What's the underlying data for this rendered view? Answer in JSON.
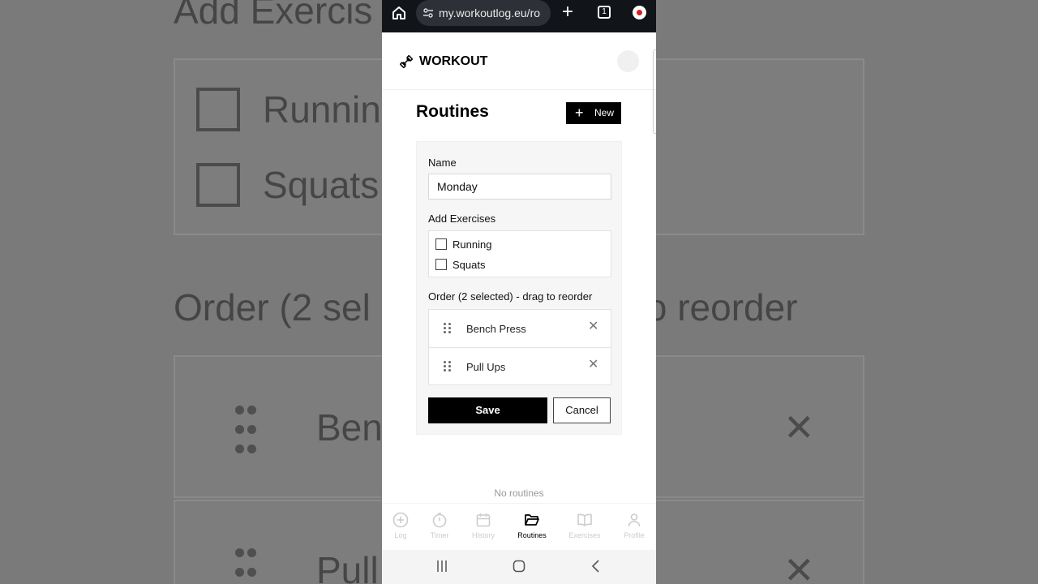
{
  "background": {
    "title_partial": "Add Exercis",
    "checkbox_items": [
      "Runnin",
      "Squats"
    ],
    "order_partial": "Order (2 sel",
    "order_partial_end": "o reorder",
    "items": [
      "Ben",
      "Pull"
    ]
  },
  "browser": {
    "url": "my.workoutlog.eu/ro",
    "tab_count": "1"
  },
  "app": {
    "brand": "WORKOUT",
    "page_title": "Routines",
    "new_button": "New",
    "form": {
      "name_label": "Name",
      "name_value": "Monday",
      "add_exercises_label": "Add Exercises",
      "exercises": [
        "Running",
        "Squats"
      ],
      "order_label": "Order (2 selected) - drag to reorder",
      "order_items": [
        "Bench Press",
        "Pull Ups"
      ],
      "save_label": "Save",
      "cancel_label": "Cancel"
    },
    "empty_text": "No routines"
  },
  "bottom_nav": {
    "items": [
      {
        "label": "Log",
        "icon": "plus-circle-icon",
        "active": false
      },
      {
        "label": "Timer",
        "icon": "stopwatch-icon",
        "active": false
      },
      {
        "label": "History",
        "icon": "calendar-icon",
        "active": false
      },
      {
        "label": "Routines",
        "icon": "folder-icon",
        "active": true
      },
      {
        "label": "Exercises",
        "icon": "book-icon",
        "active": false
      },
      {
        "label": "Profile",
        "icon": "person-icon",
        "active": false
      }
    ]
  }
}
